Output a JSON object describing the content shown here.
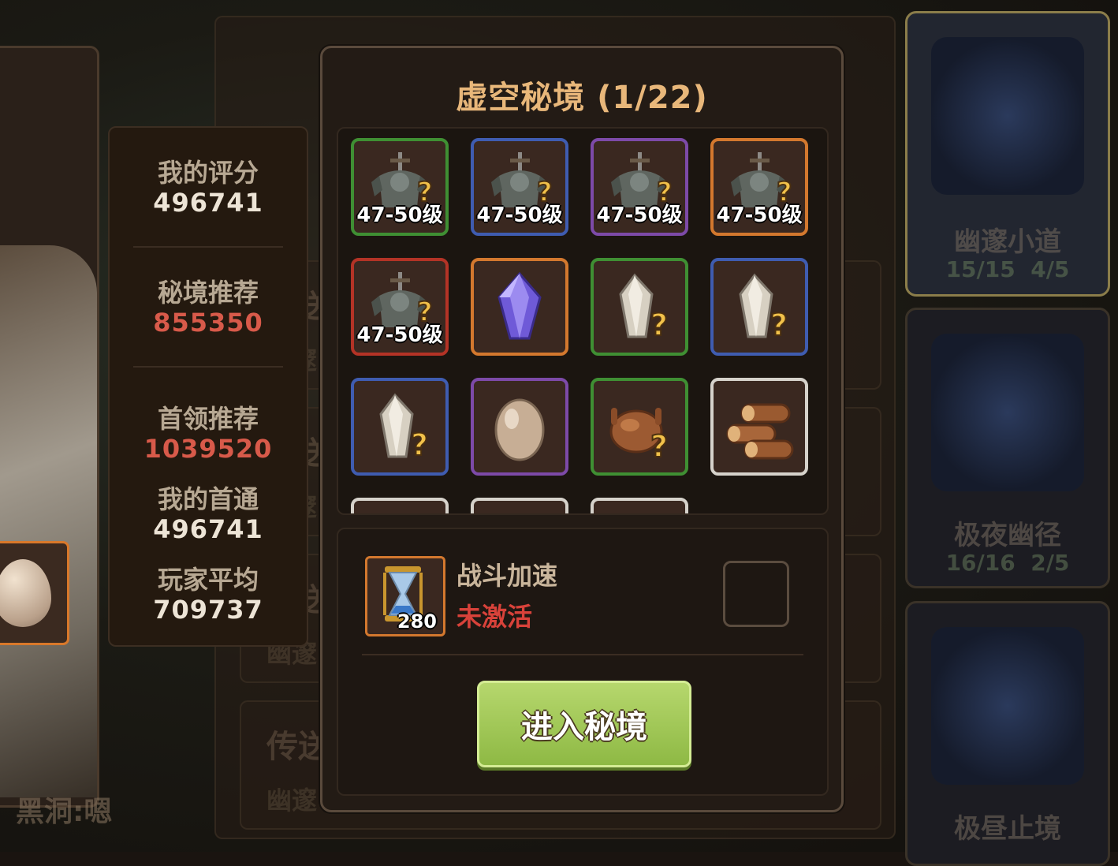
{
  "dialog": {
    "title": "虚空秘境 (1/22)",
    "rewards": [
      {
        "icon": "armor-set-mystery-icon",
        "rarity": "green",
        "level": "47-50级"
      },
      {
        "icon": "armor-set-mystery-icon",
        "rarity": "blue",
        "level": "47-50级"
      },
      {
        "icon": "armor-set-mystery-icon",
        "rarity": "purple",
        "level": "47-50级"
      },
      {
        "icon": "armor-set-mystery-icon",
        "rarity": "orange",
        "level": "47-50级"
      },
      {
        "icon": "armor-set-mystery-icon",
        "rarity": "red",
        "level": "47-50级"
      },
      {
        "icon": "purple-crystal-icon",
        "rarity": "orange",
        "level": ""
      },
      {
        "icon": "mystery-crystal-icon",
        "rarity": "green",
        "level": ""
      },
      {
        "icon": "mystery-crystal-icon",
        "rarity": "blue",
        "level": ""
      },
      {
        "icon": "mystery-crystal-icon",
        "rarity": "blue",
        "level": ""
      },
      {
        "icon": "egg-icon",
        "rarity": "purple",
        "level": ""
      },
      {
        "icon": "roast-chicken-mystery-icon",
        "rarity": "green",
        "level": ""
      },
      {
        "icon": "wood-logs-icon",
        "rarity": "white",
        "level": ""
      }
    ],
    "speed": {
      "title": "战斗加速",
      "status": "未激活",
      "count": "280",
      "checked": false
    },
    "enter_button": "进入秘境"
  },
  "stats": {
    "my_score_label": "我的评分",
    "my_score": "496741",
    "recommend_label": "秘境推荐",
    "recommend": "855350",
    "boss_label": "首领推荐",
    "boss": "1039520",
    "first_clear_label": "我的首通",
    "first_clear": "496741",
    "avg_label": "玩家平均",
    "avg": "709737"
  },
  "background": {
    "ghost_labels": [
      "传送",
      "幽邃",
      "传送",
      "幽邃",
      "传送",
      "幽邃",
      "传送",
      "幽邃"
    ],
    "bottom_name": "黑洞:嗯"
  },
  "dungeons": [
    {
      "name": "幽邃小道",
      "progress": "15/15",
      "stars": "4/5"
    },
    {
      "name": "极夜幽径",
      "progress": "16/16",
      "stars": "2/5"
    },
    {
      "name": "极昼止境"
    }
  ],
  "colors": {
    "title": "#e8b77a",
    "red_value": "#d85a4a",
    "enter_button": "#9ec657",
    "rarity_green": "#3f8f33",
    "rarity_blue": "#3f5cb0",
    "rarity_purple": "#7d4aa8",
    "rarity_orange": "#d3782e",
    "rarity_red": "#b43326",
    "rarity_white": "#d6d2cb"
  }
}
